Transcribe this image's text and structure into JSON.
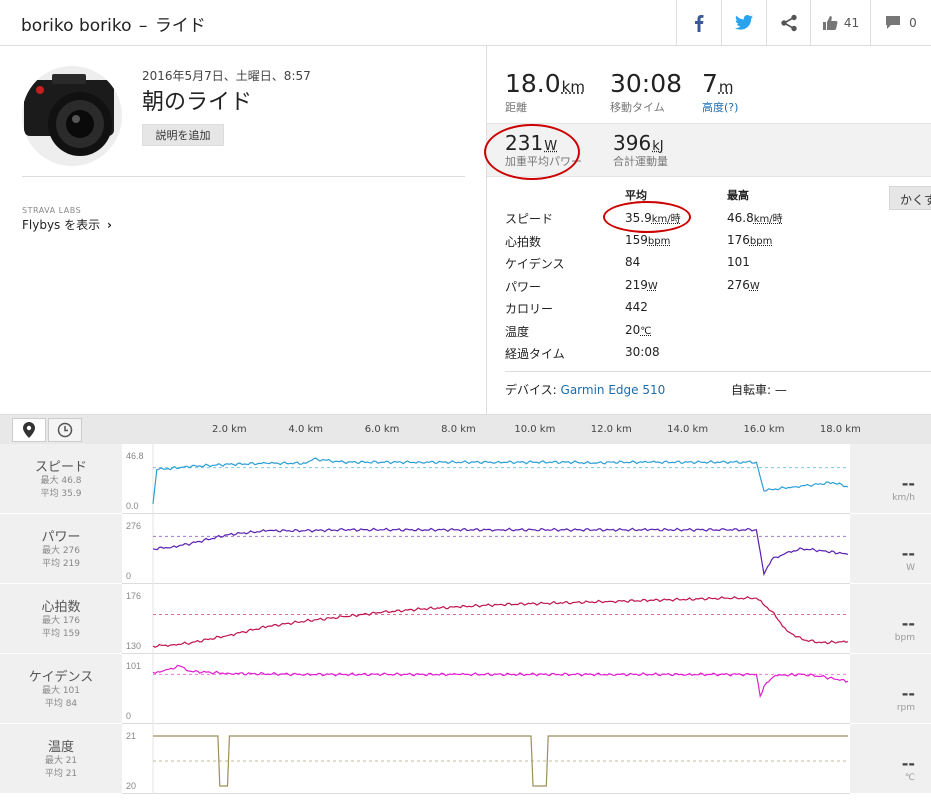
{
  "header": {
    "athlete": "boriko boriko",
    "separator": "–",
    "activity_type": "ライド",
    "kudos_count": "41",
    "comment_count": "0"
  },
  "activity": {
    "date": "2016年5月7日、土曜日、8:57",
    "title": "朝のライド",
    "add_description": "説明を追加",
    "labs_label": "STRAVA LABS",
    "flybys_label": "Flybys を表示"
  },
  "stats": {
    "distance": {
      "value": "18.0",
      "unit": "km",
      "label": "距離"
    },
    "moving_time": {
      "value": "30:08",
      "label": "移動タイム"
    },
    "elevation": {
      "value": "7",
      "unit": "m",
      "label": "高度(?)"
    },
    "weighted_power": {
      "value": "231",
      "unit": "W",
      "label": "加重平均パワー"
    },
    "work": {
      "value": "396",
      "unit": "kJ",
      "label": "合計運動量"
    }
  },
  "detail_table": {
    "col_avg": "平均",
    "col_max": "最高",
    "hide_label": "かくす",
    "rows": [
      {
        "label": "スピード",
        "avg": "35.9",
        "avg_unit": "km/時",
        "max": "46.8",
        "max_unit": "km/時"
      },
      {
        "label": "心拍数",
        "avg": "159",
        "avg_unit": "bpm",
        "max": "176",
        "max_unit": "bpm"
      },
      {
        "label": "ケイデンス",
        "avg": "84",
        "avg_unit": "",
        "max": "101",
        "max_unit": ""
      },
      {
        "label": "パワー",
        "avg": "219",
        "avg_unit": "W",
        "max": "276",
        "max_unit": "W"
      },
      {
        "label": "カロリー",
        "avg": "442",
        "avg_unit": "",
        "max": "",
        "max_unit": ""
      },
      {
        "label": "温度",
        "avg": "20",
        "avg_unit": "℃",
        "max": "",
        "max_unit": ""
      },
      {
        "label": "経過タイム",
        "avg": "30:08",
        "avg_unit": "",
        "max": "",
        "max_unit": ""
      }
    ],
    "device_label": "デバイス:",
    "device_value": "Garmin Edge 510",
    "bike_label": "自転車: —"
  },
  "colors": {
    "speed": "#2a9fd6",
    "power": "#5a1fb0",
    "heartrate": "#c0144a",
    "cadence": "#e020d0",
    "temperature": "#9c8f5a",
    "annotation": "#cc0000"
  },
  "chart_data": {
    "type": "line",
    "x_unit": "km",
    "x_ticks": [
      "2.0 km",
      "4.0 km",
      "6.0 km",
      "8.0 km",
      "10.0 km",
      "12.0 km",
      "14.0 km",
      "16.0 km",
      "18.0 km"
    ],
    "x_tick_values": [
      2,
      4,
      6,
      8,
      10,
      12,
      14,
      16,
      18
    ],
    "xlim": [
      0,
      18.2
    ],
    "panels": [
      {
        "key": "speed",
        "name": "スピード",
        "max_label": "最大 46.8",
        "avg_label": "平均 35.9",
        "unit": "km/h",
        "current": "--",
        "ylim": [
          0,
          46.8
        ],
        "y_tick_labels": [
          "46.8",
          "0.0"
        ],
        "avg": 35.9,
        "x": [
          0,
          0.1,
          0.4,
          1,
          2,
          3,
          4,
          4.2,
          5,
          6,
          7,
          8,
          9,
          10,
          11,
          11.5,
          12,
          13,
          14,
          15,
          15.8,
          16.0,
          16.3,
          16.8,
          17.3,
          17.8,
          18.2
        ],
        "y": [
          2,
          34,
          35,
          37,
          39,
          40,
          40,
          44,
          41,
          41,
          41,
          41,
          41,
          41,
          41,
          40,
          41,
          41,
          41,
          41,
          41,
          14,
          16,
          18,
          20,
          22,
          18
        ]
      },
      {
        "key": "power",
        "name": "パワー",
        "max_label": "最大 276",
        "avg_label": "平均 219",
        "unit": "W",
        "current": "--",
        "ylim": [
          0,
          276
        ],
        "y_tick_labels": [
          "276",
          "0"
        ],
        "avg": 219,
        "x": [
          0,
          0.5,
          1,
          2,
          3,
          4,
          5,
          6,
          7,
          8,
          9,
          10,
          11,
          12,
          13,
          14,
          15,
          15.8,
          16.0,
          16.2,
          16.6,
          17.0,
          17.5,
          18.2
        ],
        "y": [
          150,
          160,
          180,
          230,
          250,
          250,
          255,
          255,
          255,
          255,
          255,
          255,
          255,
          255,
          255,
          255,
          255,
          255,
          10,
          90,
          130,
          150,
          140,
          120
        ]
      },
      {
        "key": "heartrate",
        "name": "心拍数",
        "max_label": "最大 176",
        "avg_label": "平均 159",
        "unit": "bpm",
        "current": "--",
        "ylim": [
          130,
          176
        ],
        "y_tick_labels": [
          "176",
          "130"
        ],
        "avg": 159,
        "x": [
          0,
          0.5,
          1,
          2,
          3,
          4,
          5,
          6,
          7,
          8,
          9,
          10,
          11,
          12,
          13,
          14,
          15,
          15.8,
          16.2,
          16.6,
          17.0,
          17.5,
          18.2
        ],
        "y": [
          130,
          131,
          133,
          140,
          148,
          153,
          157,
          161,
          164,
          166,
          168,
          169,
          170,
          171,
          172,
          173,
          174,
          174,
          162,
          144,
          136,
          133,
          134
        ]
      },
      {
        "key": "cadence",
        "name": "ケイデンス",
        "max_label": "最大 101",
        "avg_label": "平均 84",
        "unit": "rpm",
        "current": "--",
        "ylim": [
          0,
          101
        ],
        "y_tick_labels": [
          "101",
          "0"
        ],
        "avg": 84,
        "x": [
          0,
          0.3,
          0.7,
          1,
          2,
          4,
          6,
          8,
          10,
          12,
          14,
          15.8,
          15.9,
          16.0,
          16.3,
          17,
          17.5,
          18.2
        ],
        "y": [
          88,
          92,
          101,
          90,
          86,
          84,
          84,
          84,
          84,
          84,
          84,
          84,
          40,
          60,
          82,
          84,
          80,
          70
        ]
      },
      {
        "key": "temperature",
        "name": "温度",
        "max_label": "最大 21",
        "avg_label": "平均 21",
        "unit": "℃",
        "current": "--",
        "ylim": [
          20,
          21
        ],
        "y_tick_labels": [
          "21",
          "20"
        ],
        "avg": 20.5,
        "x": [
          0,
          1.7,
          1.75,
          1.95,
          2.0,
          9.9,
          9.95,
          10.3,
          10.35,
          18.2
        ],
        "y": [
          21,
          21,
          20,
          20,
          21,
          21,
          20,
          20,
          21,
          21
        ]
      }
    ]
  }
}
